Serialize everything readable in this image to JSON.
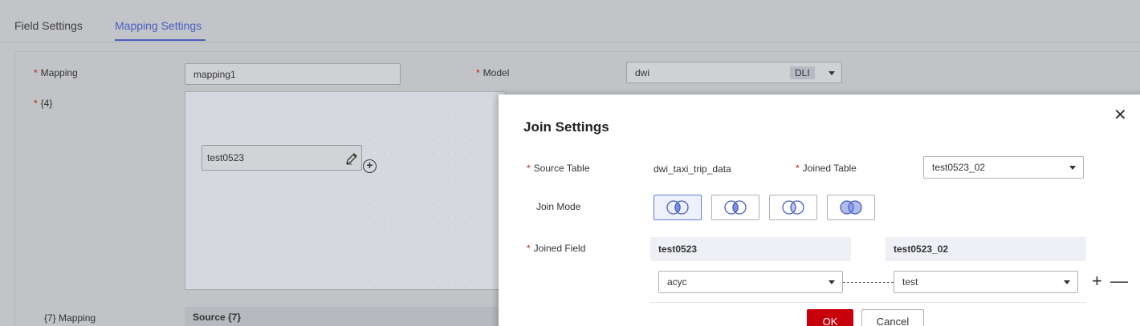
{
  "tabs": [
    {
      "label": "Field Settings",
      "active": false
    },
    {
      "label": "Mapping Settings",
      "active": true
    }
  ],
  "form": {
    "required_mark": "*",
    "mapping_label": "Mapping",
    "mapping_value": "mapping1",
    "model_label": "Model",
    "model_value": "dwi",
    "model_badge": "DLI",
    "canvas_label": "{4}",
    "canvas_node": "test0523",
    "field_mapping_label": "{7} Mapping",
    "source_header": "Source {7}"
  },
  "modal": {
    "title": "Join Settings",
    "source_table_label": "Source Table",
    "source_table_value": "dwi_taxi_trip_data",
    "joined_table_label": "Joined Table",
    "joined_table_value": "test0523_02",
    "join_mode_label": "Join Mode",
    "join_modes": [
      "inner-join",
      "left-join",
      "right-join",
      "full-join"
    ],
    "active_join_mode": "inner-join",
    "joined_field_label": "Joined Field",
    "left_table_header": "test0523",
    "right_table_header": "test0523_02",
    "left_field_value": "acyc",
    "right_field_value": "test",
    "ok_label": "OK",
    "cancel_label": "Cancel"
  },
  "colors": {
    "accent": "#4a5fbf",
    "required": "#c41a1a",
    "primary_button": "#c7000b",
    "join_fill": "#7b90e6"
  }
}
